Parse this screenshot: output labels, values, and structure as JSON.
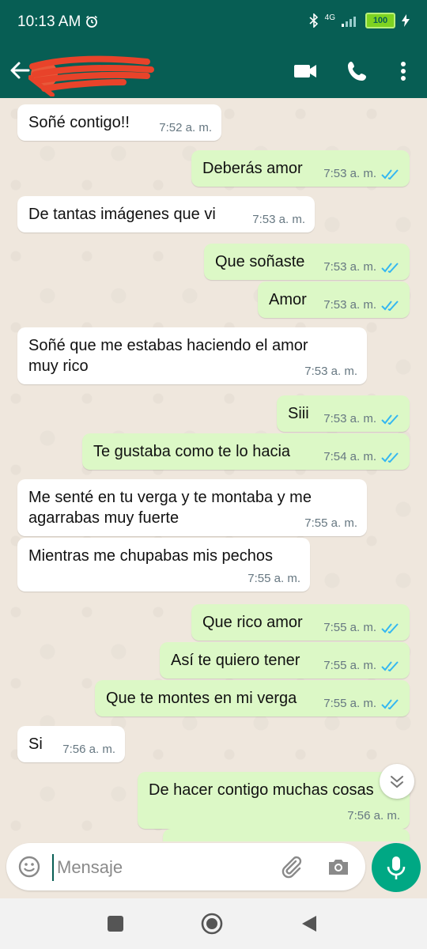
{
  "status_bar": {
    "time": "10:13 AM",
    "network": "4G",
    "battery": "100"
  },
  "header": {
    "contact_name": "",
    "icons": [
      "back-arrow-icon",
      "video-call-icon",
      "voice-call-icon",
      "more-options-icon"
    ]
  },
  "colors": {
    "header": "#075e54",
    "incoming_bubble": "#ffffff",
    "outgoing_bubble": "#dcf8c6",
    "read_ticks": "#34b7f1",
    "mic_button": "#00a884",
    "chat_background": "#efe7dd"
  },
  "messages": [
    {
      "dir": "in",
      "text": "Soñé contigo!!",
      "time": "7:52 a. m."
    },
    {
      "dir": "out",
      "text": "Deberás amor",
      "time": "7:53 a. m."
    },
    {
      "dir": "in",
      "text": "De tantas imágenes que vi",
      "time": "7:53 a. m."
    },
    {
      "dir": "out",
      "text": "Que soñaste",
      "time": "7:53 a. m."
    },
    {
      "dir": "out",
      "text": "Amor",
      "time": "7:53 a. m."
    },
    {
      "dir": "in",
      "text": "Soñé que me estabas haciendo el amor\nmuy rico",
      "time": "7:53 a. m."
    },
    {
      "dir": "out",
      "text": "Siii",
      "time": "7:53 a. m."
    },
    {
      "dir": "out",
      "text": "Te gustaba como te lo hacia",
      "time": "7:54 a. m."
    },
    {
      "dir": "in",
      "text": "Me senté en tu verga y te montaba y me\nagarrabas muy fuerte",
      "time": "7:55 a. m."
    },
    {
      "dir": "in",
      "text": "Mientras me chupabas mis pechos",
      "time": "7:55 a. m."
    },
    {
      "dir": "out",
      "text": "Que rico amor",
      "time": "7:55 a. m."
    },
    {
      "dir": "out",
      "text": "Así te quiero tener",
      "time": "7:55 a. m."
    },
    {
      "dir": "out",
      "text": "Que te montes en mi verga",
      "time": "7:55 a. m."
    },
    {
      "dir": "in",
      "text": "Si",
      "time": "7:56 a. m."
    },
    {
      "dir": "out",
      "text": "De hacer contigo muchas cosas",
      "time": "7:56 a. m."
    }
  ],
  "composer": {
    "placeholder": "Mensaje"
  }
}
